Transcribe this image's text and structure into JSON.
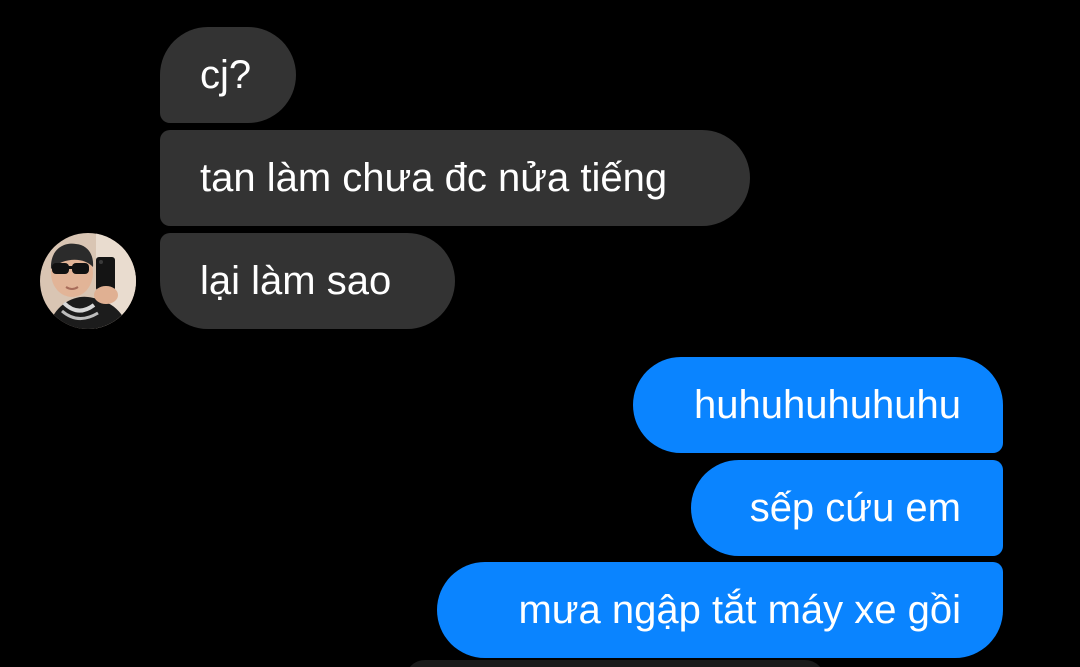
{
  "conversation": {
    "incoming": [
      {
        "text": "cj?"
      },
      {
        "text": "tan làm chưa đc nửa tiếng"
      },
      {
        "text": "lại làm sao"
      }
    ],
    "outgoing": [
      {
        "text": "huhuhuhuhuhu"
      },
      {
        "text": "sếp cứu em"
      },
      {
        "text": "mưa ngập tắt máy xe gồi"
      }
    ]
  },
  "colors": {
    "background": "#000000",
    "incoming_bubble": "#333333",
    "outgoing_bubble": "#0a84ff",
    "text": "#ffffff"
  },
  "icons": {
    "contact_avatar": "avatar"
  }
}
